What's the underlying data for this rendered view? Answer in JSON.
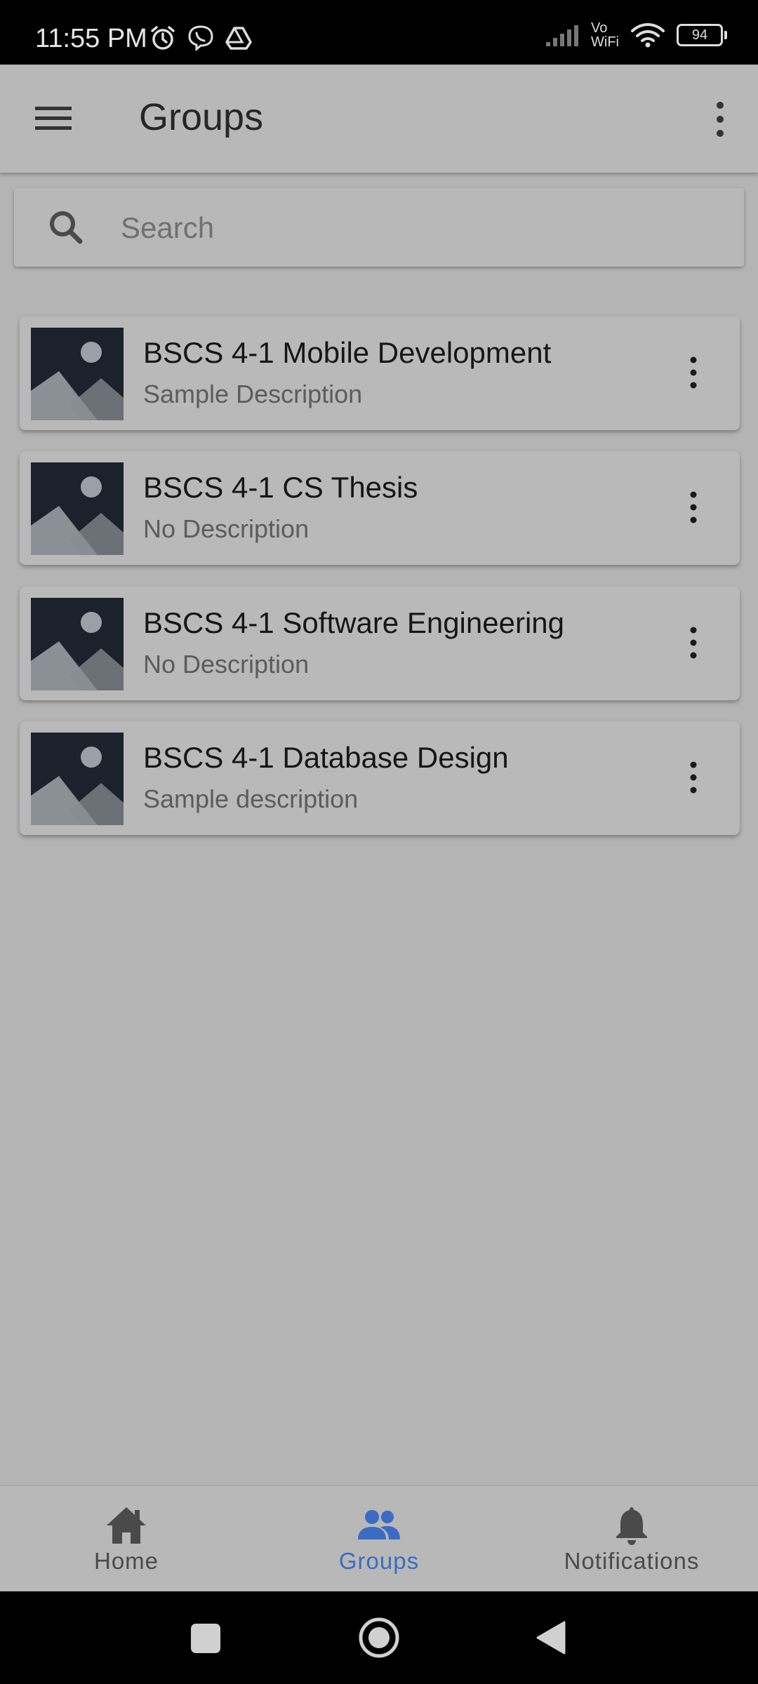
{
  "status_bar": {
    "time": "11:55 PM",
    "vowifi_top": "Vo",
    "vowifi_bottom": "WiFi",
    "battery": "94",
    "icons": [
      "alarm-icon",
      "viber-icon",
      "drive-icon",
      "signal-icon",
      "wifi-icon",
      "battery-icon"
    ]
  },
  "app_bar": {
    "title": "Groups",
    "menu_icon": "menu-icon",
    "overflow_icon": "more-vert-icon"
  },
  "search": {
    "placeholder": "Search",
    "value": ""
  },
  "groups": [
    {
      "title": "BSCS 4-1 Mobile Development",
      "description": "Sample Description"
    },
    {
      "title": "BSCS 4-1 CS Thesis",
      "description": "No Description"
    },
    {
      "title": "BSCS 4-1 Software Engineering",
      "description": "No Description"
    },
    {
      "title": "BSCS 4-1 Database Design",
      "description": "Sample description"
    }
  ],
  "bottom_nav": {
    "home": "Home",
    "groups": "Groups",
    "notifications": "Notifications",
    "active": "groups"
  },
  "colors": {
    "background": "#b4b4b4",
    "accent": "#3a6cc4",
    "thumbnail_bg": "#1b222c"
  }
}
